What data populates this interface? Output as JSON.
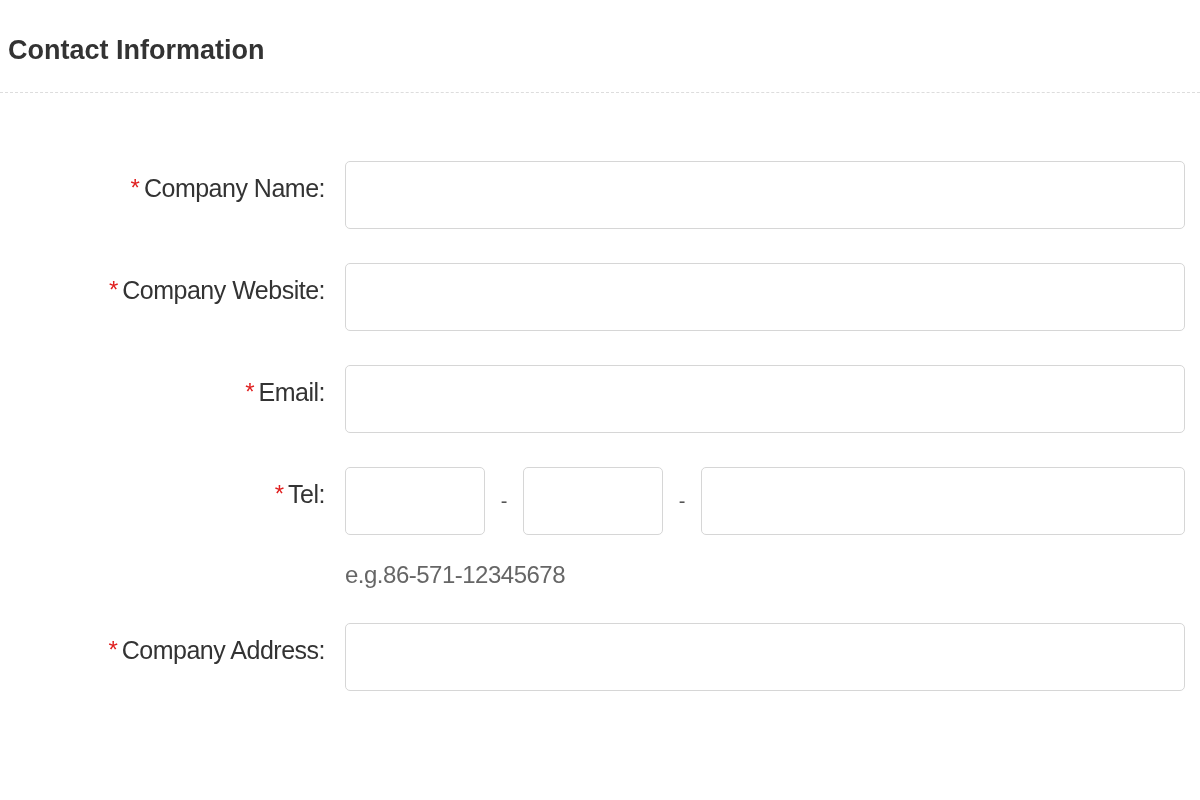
{
  "section": {
    "title": "Contact Information"
  },
  "fields": [
    {
      "kind": "text",
      "required_mark": "*",
      "label": "Company Name:"
    },
    {
      "kind": "text",
      "required_mark": "*",
      "label": "Company Website:"
    },
    {
      "kind": "text",
      "required_mark": "*",
      "label": "Email:"
    },
    {
      "kind": "phone",
      "required_mark": "*",
      "label": "Tel:",
      "separators": [
        "-",
        "-"
      ],
      "hint": "e.g.86-571-12345678"
    },
    {
      "kind": "text",
      "required_mark": "*",
      "label": "Company Address:"
    }
  ]
}
